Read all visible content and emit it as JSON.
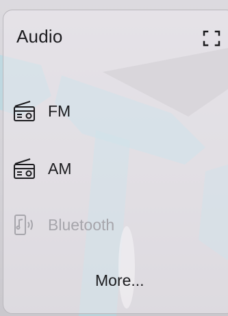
{
  "card": {
    "title": "Audio",
    "expand_icon": "expand-icon"
  },
  "sources": [
    {
      "label": "FM",
      "icon": "radio-icon",
      "enabled": true
    },
    {
      "label": "AM",
      "icon": "radio-icon",
      "enabled": true
    },
    {
      "label": "Bluetooth",
      "icon": "phone-audio-icon",
      "enabled": false
    }
  ],
  "footer": {
    "more_label": "More..."
  },
  "colors": {
    "text": "#1b1b1e",
    "disabled_text": "#a6a5ab",
    "wallpaper_accent": "#a9dbe6"
  }
}
